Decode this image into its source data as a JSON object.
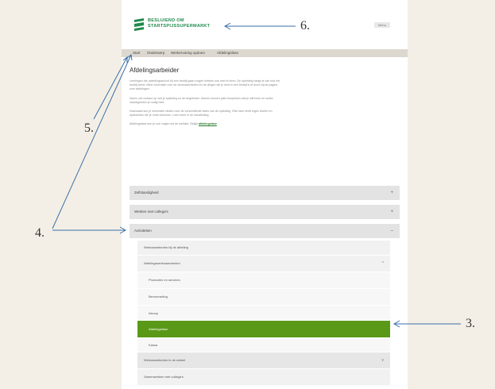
{
  "header": {
    "logo_line1": "BESLUIEND OM",
    "logo_line2": "STARTSPIJSSUPERMARKT",
    "button_label": "Menu"
  },
  "breadcrumb": [
    "Start",
    "Onderwerp",
    "Werkervaring opdoen",
    "Afdelingsfase"
  ],
  "main": {
    "title": "Afdelingsarbeider",
    "paragraphs": [
      "Leerlingen die opleidingsschool bij een bedrijf gaan volgen hebben ook veel te leren. De opleiding hangt af van hoe het bedrijf werkt. Meer informatie over de werkzaamheden en de dingen die je leert in een bedrijf is te lezen bij de pagina over afdelingen.",
      "Neem ook contact op met je opleiding en de begeleider. Samen kunnen jullie bespreken wat je wilt leren en welke vaardigheden je nodig hebt.",
      "Daarnaast kun je informatie vinden over de verschillende fases van de opleiding. Elke fase heeft eigen doelen en opdrachten die je moet uitvoeren. Lees meer in de handleiding."
    ],
    "closing_text": "Afdelingsfase kun je ook volgen via de website. Bekijk",
    "closing_link": "afdelingsfase"
  },
  "accordion": [
    {
      "label": "Zelfstandigheid",
      "icon": "plus"
    },
    {
      "label": "Werken met collega's",
      "icon": "plus"
    },
    {
      "label": "Activiteiten",
      "icon": "minus"
    }
  ],
  "submenu": [
    {
      "label": "Werkzaamheden bij de afdeling",
      "icon": "",
      "level": 1
    },
    {
      "label": "Afdelingswerkzaamheden",
      "icon": "chevron-up",
      "level": 1
    },
    {
      "label": "Producten en services",
      "icon": "",
      "level": 2
    },
    {
      "label": "Bevoorrading",
      "icon": "",
      "level": 2
    },
    {
      "label": "Inkoop",
      "icon": "",
      "level": 2
    },
    {
      "label": "Afdelingsfase",
      "icon": "",
      "level": 2,
      "active": true
    },
    {
      "label": "Kassa",
      "icon": "",
      "level": 2
    },
    {
      "label": "Werkzaamheden in de winkel",
      "icon": "chevron-down",
      "level": 1
    },
    {
      "label": "Samenwerken met collega's",
      "icon": "",
      "level": 1
    }
  ],
  "annotations": [
    "6.",
    "5.",
    "4.",
    "3."
  ],
  "colors": {
    "brand_green": "#1f8a4c",
    "active_green": "#5a9918",
    "background": "#f4efe6"
  }
}
